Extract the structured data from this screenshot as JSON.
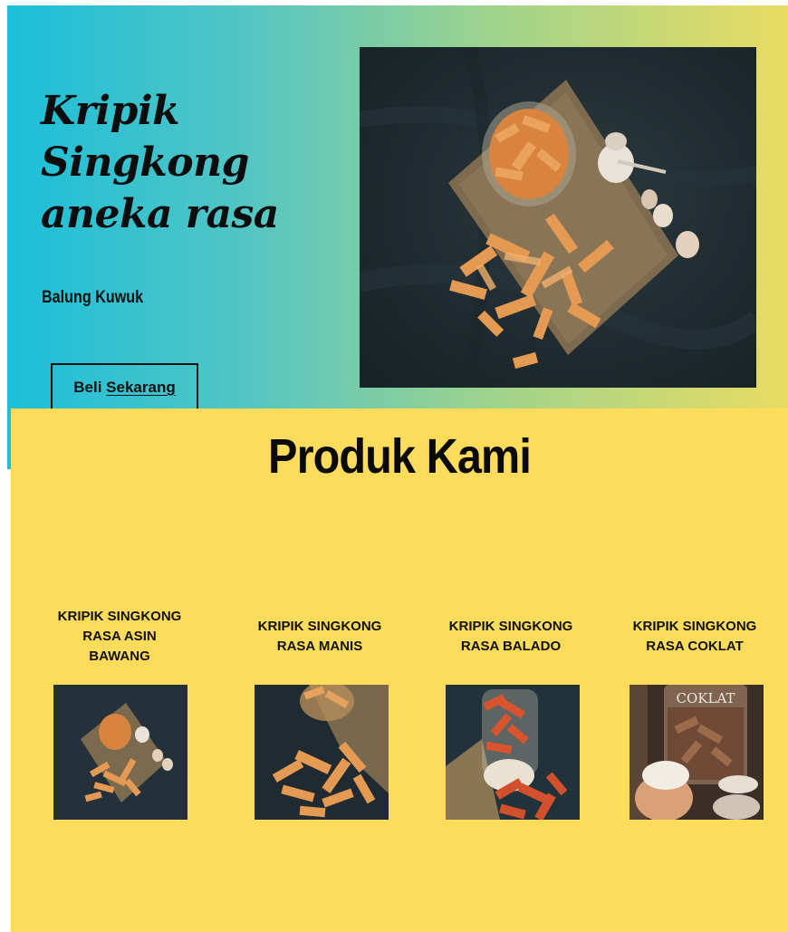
{
  "hero": {
    "title_lines": [
      "Kripik",
      "Singkong",
      "aneka rasa"
    ],
    "subtitle": "Balung Kuwuk",
    "button": {
      "label_plain": "Beli ",
      "label_underlined": "Sekarang"
    }
  },
  "products": {
    "heading": "Produk Kami",
    "items": [
      {
        "name_lines": [
          "KRIPIK SINGKONG",
          "RASA ASIN",
          "BAWANG"
        ]
      },
      {
        "name_lines": [
          "KRIPIK SINGKONG",
          "RASA MANIS"
        ]
      },
      {
        "name_lines": [
          "KRIPIK SINGKONG",
          "RASA BALADO"
        ]
      },
      {
        "name_lines": [
          "KRIPIK SINGKONG",
          "RASA COKLAT"
        ],
        "image_text": "COKLAT"
      }
    ]
  },
  "colors": {
    "gradient_start": "#1bbfda",
    "gradient_end": "#e9dc62",
    "products_bg": "#fddc5c",
    "text": "#0d0d0d"
  }
}
